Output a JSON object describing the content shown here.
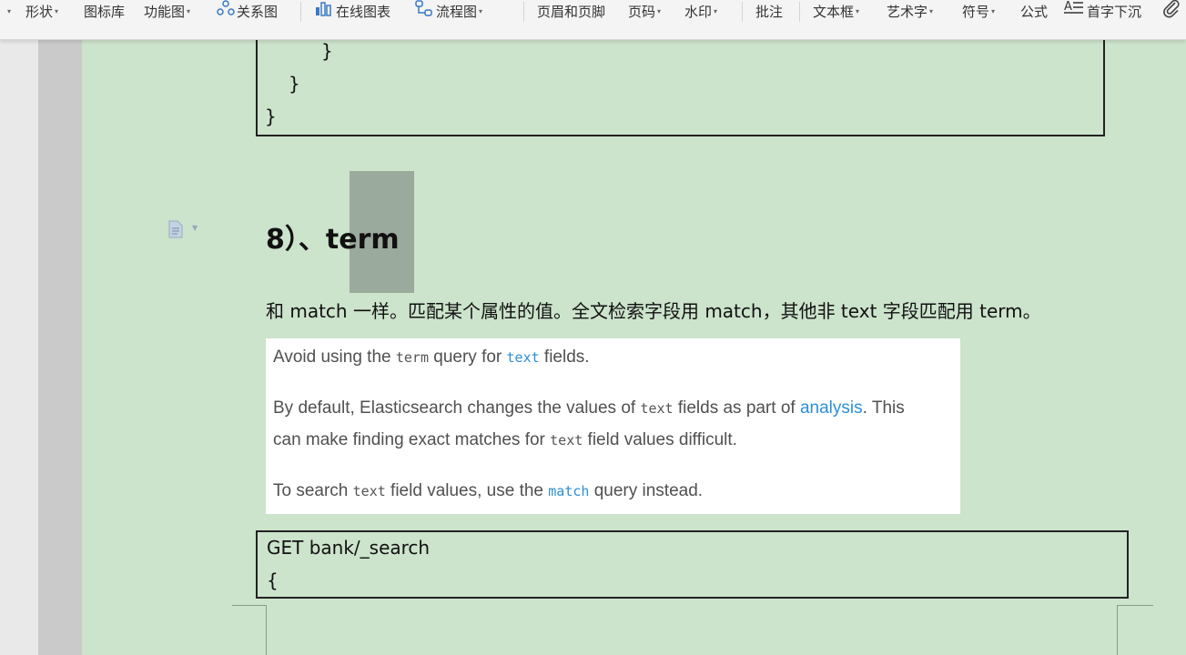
{
  "toolbar": {
    "items": [
      {
        "label": "形状",
        "has_caret": true
      },
      {
        "label": "图标库",
        "has_caret": false
      },
      {
        "label": "功能图",
        "has_caret": true
      },
      {
        "label": "关系图",
        "has_caret": false,
        "icon": "relation-icon"
      },
      {
        "label": "在线图表",
        "has_caret": false,
        "icon": "chart-icon"
      },
      {
        "label": "流程图",
        "has_caret": true,
        "icon": "flowchart-icon"
      },
      {
        "label": "页眉和页脚",
        "has_caret": false
      },
      {
        "label": "页码",
        "has_caret": true
      },
      {
        "label": "水印",
        "has_caret": true
      },
      {
        "label": "批注",
        "has_caret": false
      },
      {
        "label": "文本框",
        "has_caret": true
      },
      {
        "label": "艺术字",
        "has_caret": true
      },
      {
        "label": "符号",
        "has_caret": true
      },
      {
        "label": "公式",
        "has_caret": false
      },
      {
        "label": "首字下沉",
        "has_caret": false,
        "icon": "dropcap-icon"
      }
    ]
  },
  "code_top": {
    "lines": [
      "}",
      "}",
      "}"
    ]
  },
  "section": {
    "heading_prefix": "8）、",
    "heading_term": "term",
    "paragraph": "和 match 一样。匹配某个属性的值。全文检索字段用 match，其他非 text 字段匹配用 term。"
  },
  "note": {
    "line1_a": "Avoid using the ",
    "line1_code": "term",
    "line1_b": " query for ",
    "line1_code2": "text",
    "line1_c": " fields.",
    "line2_a": "By default, Elasticsearch changes the values of ",
    "line2_code": "text",
    "line2_b": " fields as part of ",
    "line2_link": "analysis",
    "line2_c": ". This",
    "line3_a": "can make finding exact matches for ",
    "line3_code": "text",
    "line3_b": " field values difficult.",
    "line4_a": "To search ",
    "line4_code": "text",
    "line4_b": " field values, use the ",
    "line4_code2": "match",
    "line4_c": " query instead."
  },
  "code_bottom": {
    "lines": [
      "GET bank/_search",
      "{"
    ]
  }
}
